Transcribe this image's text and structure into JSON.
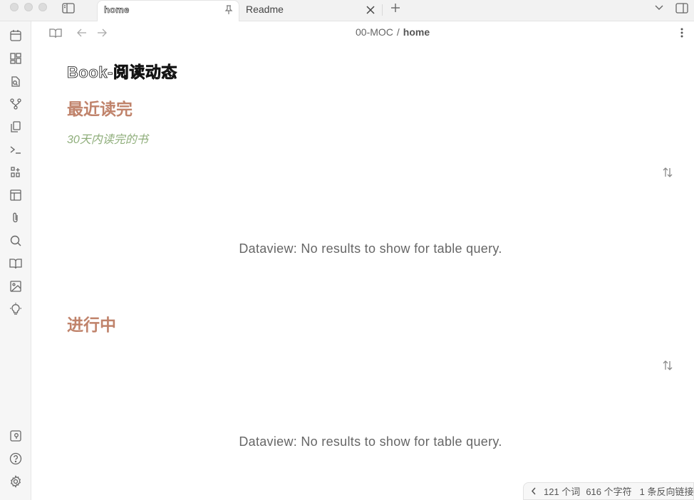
{
  "tabs": [
    {
      "label": "home",
      "active": true
    },
    {
      "label": "Readme",
      "active": false
    }
  ],
  "breadcrumb": {
    "folder": "00-MOC",
    "separator": "/",
    "current": "home"
  },
  "document": {
    "title": "Book-阅读动态",
    "sections": [
      {
        "heading": "最近读完",
        "subtitle": "30天内读完的书",
        "empty_message": "Dataview: No results to show for table query."
      },
      {
        "heading": "进行中",
        "empty_message": "Dataview: No results to show for table query."
      }
    ]
  },
  "status_bar": {
    "words": "121 个词",
    "characters": "616 个字符",
    "backlinks": "1 条反向链接"
  },
  "ribbon_icons": [
    "calendar-icon",
    "dashboard-icon",
    "file-search-icon",
    "git-branch-icon",
    "copy-icon",
    "terminal-icon",
    "blocks-icon",
    "layout-icon",
    "paperclip-icon",
    "search-icon",
    "book-open-icon",
    "image-icon",
    "lightbulb-icon",
    "vault-icon",
    "help-icon",
    "settings-icon"
  ],
  "colors": {
    "heading": "#c0836b",
    "subtitle": "#8fae7b",
    "ribbon_bg": "#f6f6f6",
    "tabbar_bg": "#f2f2f2"
  }
}
